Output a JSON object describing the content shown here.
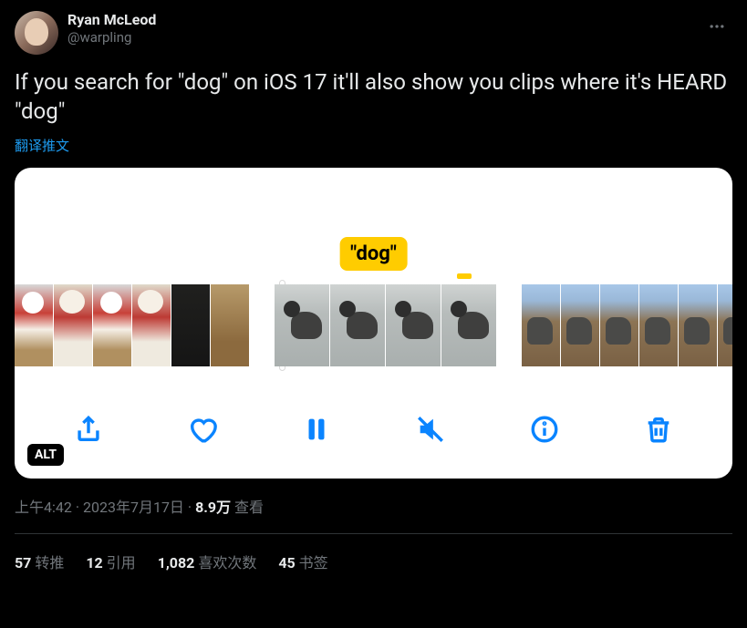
{
  "user": {
    "display_name": "Ryan McLeod",
    "handle": "@warpling"
  },
  "tweet": {
    "text": "If you search for \"dog\" on iOS 17 it'll also show you clips where it's HEARD \"dog\"",
    "translate_label": "翻译推文"
  },
  "media": {
    "caption_tag": "\"dog\"",
    "alt_badge": "ALT"
  },
  "meta": {
    "time": "上午4:42",
    "date": "2023年7月17日",
    "views_value": "8.9万",
    "views_label": "查看",
    "dot": " · "
  },
  "stats": {
    "retweets": {
      "count": "57",
      "label": "转推"
    },
    "quotes": {
      "count": "12",
      "label": "引用"
    },
    "likes": {
      "count": "1,082",
      "label": "喜欢次数"
    },
    "bookmarks": {
      "count": "45",
      "label": "书签"
    }
  }
}
